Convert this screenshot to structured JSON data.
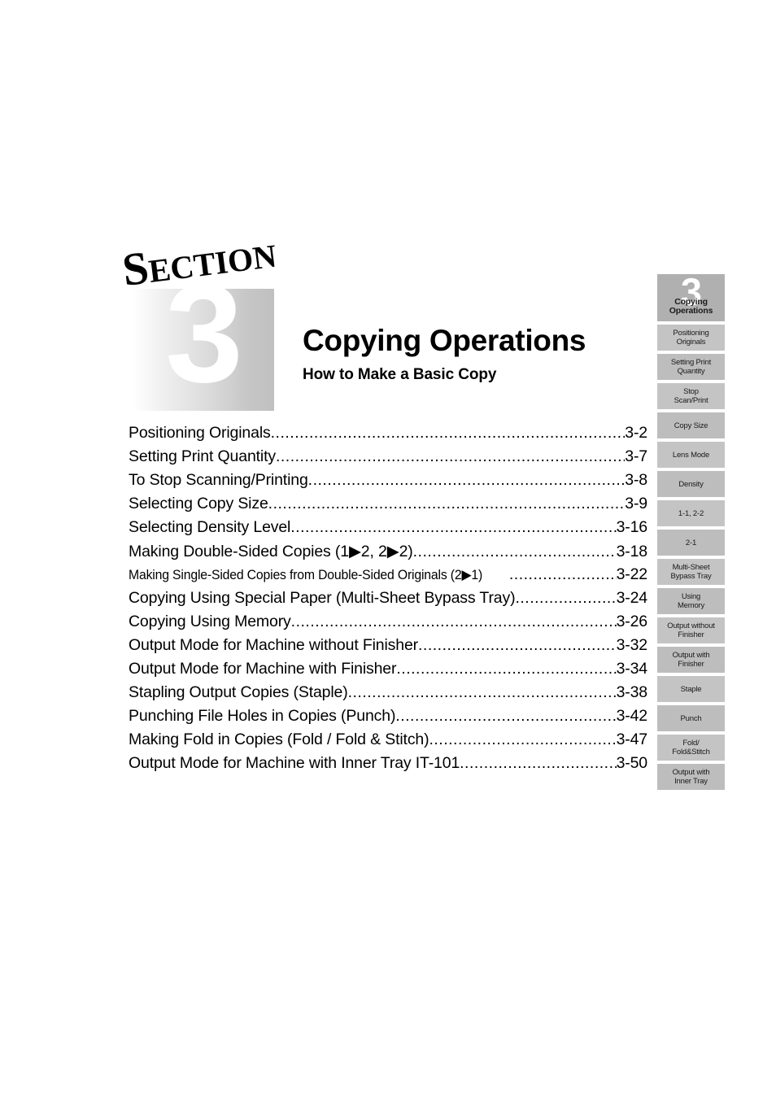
{
  "banner": {
    "section_word": "Section",
    "section_number": "3",
    "chapter_title": "Copying Operations",
    "chapter_subtitle": "How to Make a Basic Copy"
  },
  "toc": {
    "leader_dots": "................................................................................................................................",
    "entries": [
      {
        "label": "Positioning Originals",
        "page": "3-2",
        "condensed": false
      },
      {
        "label": "Setting Print Quantity",
        "page": "3-7",
        "condensed": false
      },
      {
        "label": "To Stop Scanning/Printing",
        "page": "3-8",
        "condensed": false
      },
      {
        "label": "Selecting Copy Size",
        "page": "3-9",
        "condensed": false
      },
      {
        "label": "Selecting Density Level",
        "page": "3-16",
        "condensed": false
      },
      {
        "label": "Making Double-Sided Copies (1▶2, 2▶2)",
        "page": "3-18",
        "condensed": false
      },
      {
        "label": "Making Single-Sided Copies from Double-Sided Originals (2▶1)",
        "page": "3-22",
        "condensed": true
      },
      {
        "label": "Copying Using Special Paper (Multi-Sheet Bypass Tray)",
        "page": "3-24",
        "condensed": false
      },
      {
        "label": "Copying Using Memory",
        "page": "3-26",
        "condensed": false
      },
      {
        "label": "Output Mode for Machine without Finisher",
        "page": "3-32",
        "condensed": false
      },
      {
        "label": "Output Mode for Machine with Finisher",
        "page": "3-34",
        "condensed": false
      },
      {
        "label": "Stapling Output Copies (Staple)",
        "page": "3-38",
        "condensed": false
      },
      {
        "label": "Punching File Holes in Copies (Punch)",
        "page": "3-42",
        "condensed": false
      },
      {
        "label": "Making Fold in Copies (Fold / Fold & Stitch)",
        "page": "3-47",
        "condensed": false
      },
      {
        "label": "Output Mode for Machine with Inner Tray IT-101",
        "page": "3-50",
        "condensed": false
      }
    ]
  },
  "tabs": {
    "items": [
      {
        "label": "Copying\nOperations",
        "number": "3",
        "current": true
      },
      {
        "label": "Positioning\nOriginals",
        "current": false
      },
      {
        "label": "Setting Print\nQuantity",
        "current": false
      },
      {
        "label": "Stop\nScan/Print",
        "current": false
      },
      {
        "label": "Copy Size",
        "current": false
      },
      {
        "label": "Lens Mode",
        "current": false
      },
      {
        "label": "Density",
        "current": false
      },
      {
        "label": "1-1, 2-2",
        "current": false
      },
      {
        "label": "2-1",
        "current": false
      },
      {
        "label": "Multi-Sheet\nBypass Tray",
        "current": false
      },
      {
        "label": "Using\nMemory",
        "current": false
      },
      {
        "label": "Output without\nFinisher",
        "current": false
      },
      {
        "label": "Output with\nFinisher",
        "current": false
      },
      {
        "label": "Staple",
        "current": false
      },
      {
        "label": "Punch",
        "current": false
      },
      {
        "label": "Fold/\nFold&Stitch",
        "current": false
      },
      {
        "label": "Output with\nInner Tray",
        "current": false
      }
    ]
  },
  "colors": {
    "tab_background": "#c4c4c4",
    "tab_background_alt": "#bdbdbd",
    "tab_current_background": "#b0b0b0",
    "banner_gradient_start": "#ffffff",
    "banner_gradient_end": "#c0c0c0"
  }
}
